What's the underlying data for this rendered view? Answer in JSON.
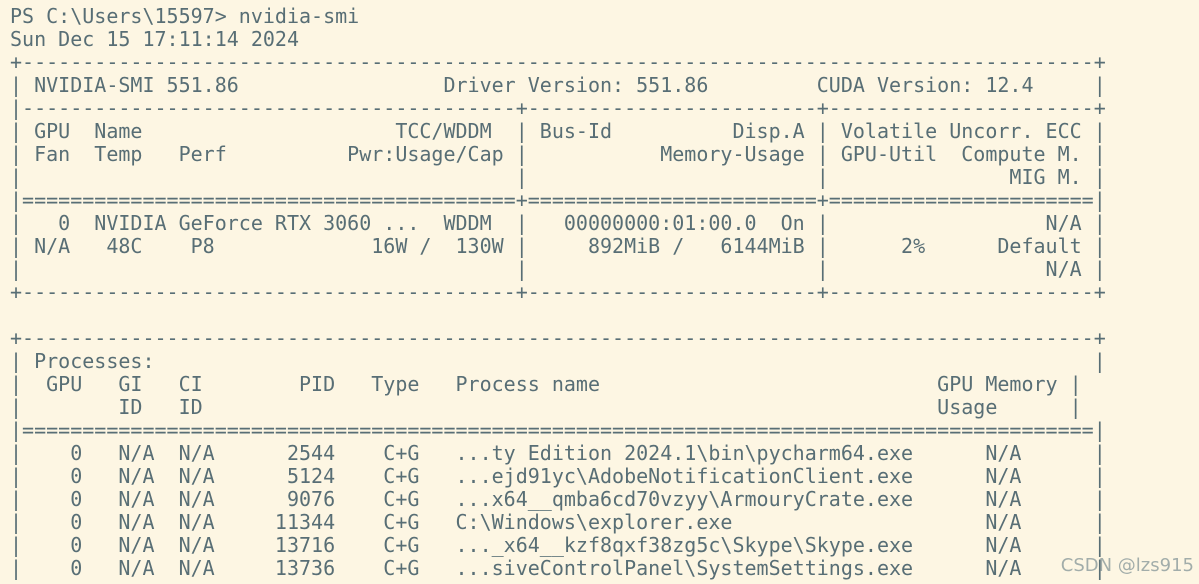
{
  "terminal": {
    "lines": [
      "PS C:\\Users\\15597> nvidia-smi",
      "Sun Dec 15 17:11:14 2024",
      "+-----------------------------------------------------------------------------------------+",
      "| NVIDIA-SMI 551.86                 Driver Version: 551.86         CUDA Version: 12.4     |",
      "|-----------------------------------------+------------------------+----------------------+",
      "| GPU  Name                     TCC/WDDM  | Bus-Id          Disp.A | Volatile Uncorr. ECC |",
      "| Fan  Temp   Perf          Pwr:Usage/Cap |           Memory-Usage | GPU-Util  Compute M. |",
      "|                                         |                        |               MIG M. |",
      "|=========================================+========================+======================|",
      "|   0  NVIDIA GeForce RTX 3060 ...  WDDM  |   00000000:01:00.0  On |                  N/A |",
      "| N/A   48C    P8             16W /  130W |     892MiB /   6144MiB |      2%      Default |",
      "|                                         |                        |                  N/A |",
      "+-----------------------------------------+------------------------+----------------------+",
      "",
      "+-----------------------------------------------------------------------------------------+",
      "| Processes:                                                                              |",
      "|  GPU   GI   CI        PID   Type   Process name                            GPU Memory |",
      "|        ID   ID                                                             Usage      |",
      "|=========================================================================================|",
      "|    0   N/A  N/A      2544    C+G   ...ty Edition 2024.1\\bin\\pycharm64.exe      N/A      |",
      "|    0   N/A  N/A      5124    C+G   ...ejd91yc\\AdobeNotificationClient.exe      N/A      |",
      "|    0   N/A  N/A      9076    C+G   ...x64__qmba6cd70vzyy\\ArmouryCrate.exe      N/A      |",
      "|    0   N/A  N/A     11344    C+G   C:\\Windows\\explorer.exe                     N/A      |",
      "|    0   N/A  N/A     13716    C+G   ..._x64__kzf8qxf38zg5c\\Skype\\Skype.exe      N/A      |",
      "|    0   N/A  N/A     13736    C+G   ...siveControlPanel\\SystemSettings.exe      N/A      |"
    ]
  },
  "watermark": "CSDN @lzs915"
}
